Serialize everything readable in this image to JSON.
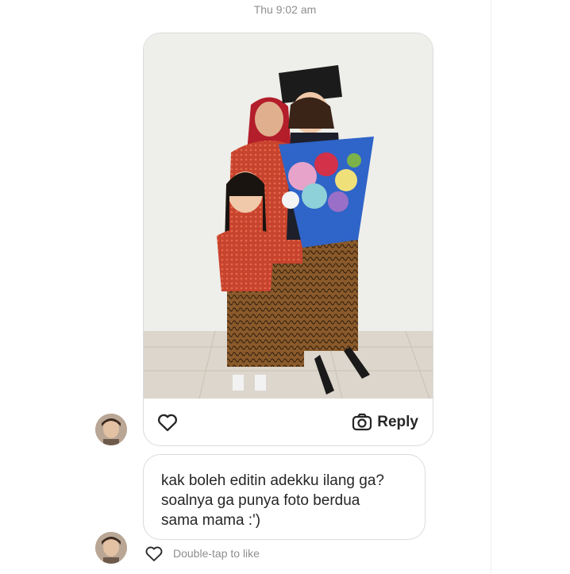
{
  "thread": {
    "timestamp": "Thu 9:02 am"
  },
  "photo_message": {
    "reply_label": "Reply",
    "like_icon": "heart-outline-icon",
    "reply_icon": "camera-icon"
  },
  "text_message": {
    "text": "kak boleh editin adekku ilang ga?\nsoalnya ga punya foto berdua\nsama mama :')",
    "hint": "Double-tap to like",
    "like_icon": "heart-outline-icon"
  },
  "colors": {
    "border": "#dbdbdb",
    "text": "#262626",
    "muted": "#8e8e8e"
  }
}
